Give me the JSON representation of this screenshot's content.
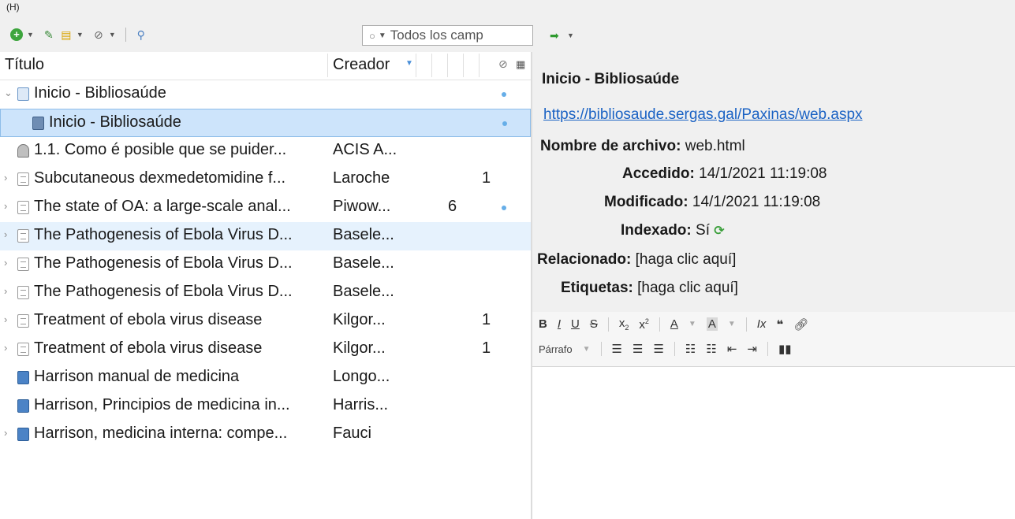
{
  "toolbar": {
    "menu_letter": "(H)",
    "search_placeholder": "Todos los camp"
  },
  "columns": {
    "title": "Título",
    "creator": "Creador"
  },
  "items": [
    {
      "title": "Inicio - Bibliosaúde",
      "creator": "",
      "count": "",
      "icon": "webpage-icon",
      "expander": "open",
      "dot": true,
      "state": ""
    },
    {
      "title": "Inicio - Bibliosaúde",
      "creator": "",
      "count": "",
      "icon": "snapshot-icon",
      "expander": "none",
      "dot": true,
      "state": "selected",
      "child": true
    },
    {
      "title": "1.1. Como é posible que se puider...",
      "creator": "ACIS A...",
      "count": "",
      "icon": "presentation-icon",
      "expander": "none",
      "dot": false,
      "state": ""
    },
    {
      "title": "Subcutaneous dexmedetomidine f...",
      "creator": "Laroche",
      "count": "1",
      "icon": "document-icon",
      "expander": "closed",
      "dot": false,
      "state": ""
    },
    {
      "title": "The state of OA: a large-scale anal...",
      "creator": "Piwow...",
      "count": "6",
      "icon": "document-icon",
      "expander": "closed",
      "dot": true,
      "state": ""
    },
    {
      "title": "The Pathogenesis of Ebola Virus D...",
      "creator": "Basele...",
      "count": "",
      "icon": "document-icon",
      "expander": "closed",
      "dot": false,
      "state": "hover"
    },
    {
      "title": "The Pathogenesis of Ebola Virus D...",
      "creator": "Basele...",
      "count": "",
      "icon": "document-icon",
      "expander": "closed",
      "dot": false,
      "state": ""
    },
    {
      "title": "The Pathogenesis of Ebola Virus D...",
      "creator": "Basele...",
      "count": "",
      "icon": "document-icon",
      "expander": "closed",
      "dot": false,
      "state": ""
    },
    {
      "title": "Treatment of ebola virus disease",
      "creator": "Kilgor...",
      "count": "1",
      "icon": "document-icon",
      "expander": "closed",
      "dot": false,
      "state": ""
    },
    {
      "title": "Treatment of ebola virus disease",
      "creator": "Kilgor...",
      "count": "1",
      "icon": "document-icon",
      "expander": "closed",
      "dot": false,
      "state": ""
    },
    {
      "title": "Harrison manual de medicina",
      "creator": "Longo...",
      "count": "",
      "icon": "book-icon",
      "expander": "none",
      "dot": false,
      "state": ""
    },
    {
      "title": "Harrison, Principios de medicina in...",
      "creator": "Harris...",
      "count": "",
      "icon": "book-icon",
      "expander": "none",
      "dot": false,
      "state": ""
    },
    {
      "title": "Harrison, medicina interna: compe...",
      "creator": "Fauci",
      "count": "",
      "icon": "book-icon",
      "expander": "closed",
      "dot": false,
      "state": ""
    }
  ],
  "detail": {
    "title": "Inicio - Bibliosaúde",
    "url": "https://bibliosaude.sergas.gal/Paxinas/web.aspx",
    "filename_label": "Nombre de archivo:",
    "filename_value": "web.html",
    "accessed_label": "Accedido:",
    "accessed_value": "14/1/2021 11:19:08",
    "modified_label": "Modificado:",
    "modified_value": "14/1/2021 11:19:08",
    "indexed_label": "Indexado:",
    "indexed_value": "Sí",
    "related_label": "Relacionado:",
    "related_value": "[haga clic aquí]",
    "tags_label": "Etiquetas:",
    "tags_value": "[haga clic aquí]"
  },
  "editor": {
    "paragraph_format": "Párrafo"
  }
}
